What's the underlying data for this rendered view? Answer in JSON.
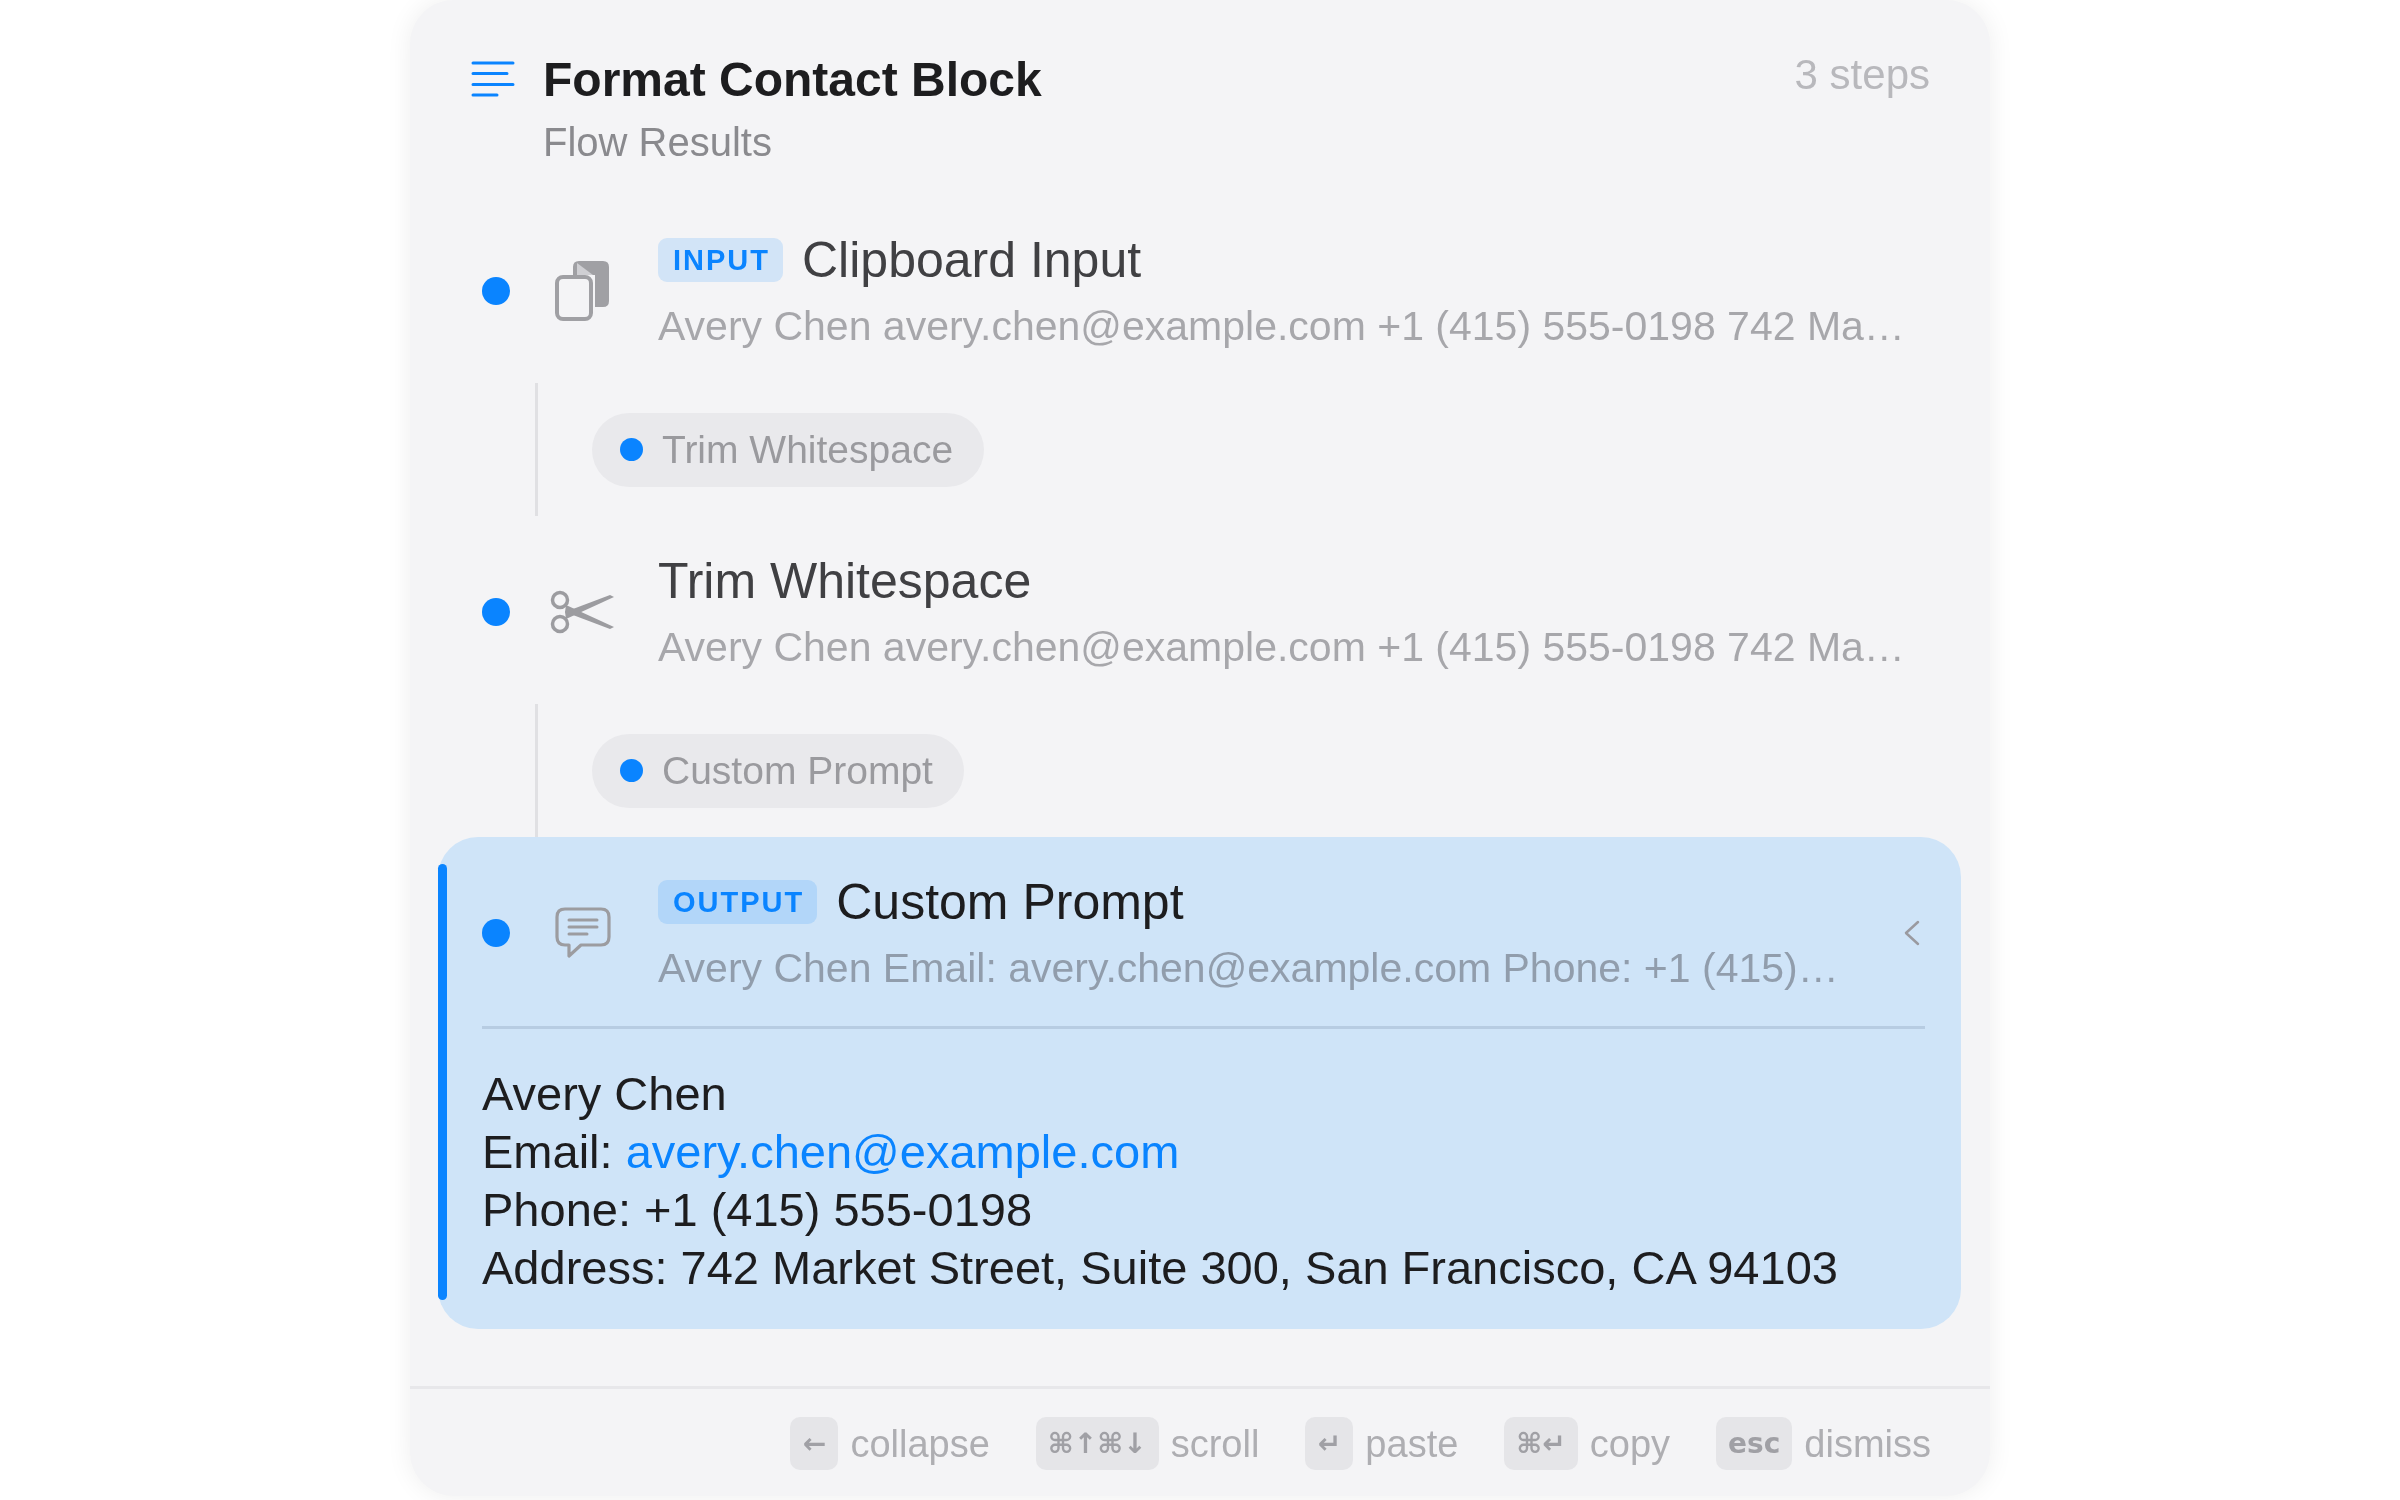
{
  "header": {
    "title": "Format Contact Block",
    "subtitle": "Flow Results",
    "step_count": "3 steps"
  },
  "steps": [
    {
      "kind": "clipboard",
      "badge": "INPUT",
      "title": "Clipboard Input",
      "preview": "Avery Chen avery.chen@example.com +1 (415) 555-0198 742 Ma…",
      "selected": false,
      "expanded": false,
      "connector": {
        "label": "Trim Whitespace"
      }
    },
    {
      "kind": "trim",
      "title": "Trim Whitespace",
      "preview": "Avery Chen avery.chen@example.com +1 (415) 555-0198 742 Ma…",
      "selected": false,
      "expanded": false,
      "connector": {
        "label": "Custom Prompt"
      }
    },
    {
      "kind": "prompt",
      "badge": "OUTPUT",
      "title": "Custom Prompt",
      "preview": "Avery Chen Email: avery.chen@example.com Phone: +1 (415)…",
      "selected": true,
      "expanded": true,
      "output": [
        {
          "text": "Avery Chen"
        },
        {
          "text": "Email:",
          "link": "avery.chen@example.com"
        },
        {
          "text": "Phone: +1 (415) 555-0198"
        },
        {
          "text": "Address: 742 Market Street, Suite 300, San Francisco, CA 94103"
        }
      ]
    }
  ],
  "footer": {
    "shortcuts": [
      {
        "key": "←",
        "label": "collapse"
      },
      {
        "key": "⌘↑⌘↓",
        "label": "scroll"
      },
      {
        "key": "↵",
        "label": "paste"
      },
      {
        "key": "⌘↵",
        "label": "copy"
      },
      {
        "key": "esc",
        "label": "dismiss"
      }
    ]
  }
}
